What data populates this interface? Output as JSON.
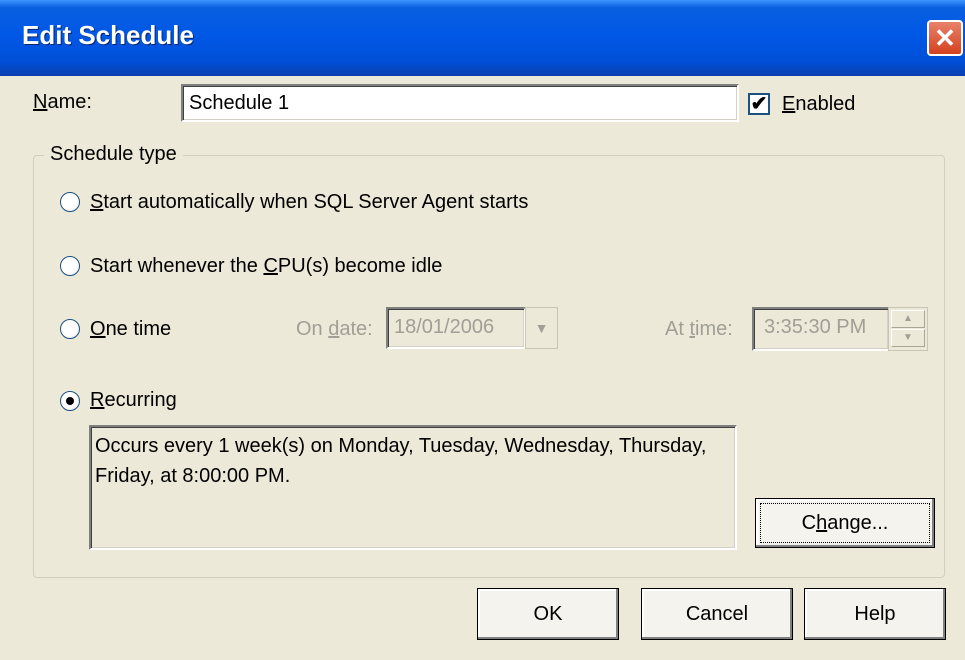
{
  "dialog": {
    "title": "Edit Schedule",
    "close_glyph": "✕"
  },
  "name": {
    "label": "Name:",
    "value": "Schedule 1"
  },
  "enabled": {
    "label": "Enabled",
    "checked": true,
    "check_glyph": "✔"
  },
  "schedule_type": {
    "label": "Schedule type",
    "options": [
      {
        "label": "Start automatically when SQL Server Agent starts",
        "selected": false
      },
      {
        "label": "Start whenever the CPU(s) become idle",
        "selected": false
      },
      {
        "label": "One time",
        "selected": false
      },
      {
        "label": "Recurring",
        "selected": true
      }
    ],
    "on_date_label": "On date:",
    "on_date_value": "18/01/2006",
    "at_time_label": "At time:",
    "at_time_value": "3:35:30 PM",
    "recurring_description": "Occurs every 1 week(s) on Monday, Tuesday, Wednesday, Thursday, Friday, at 8:00:00 PM.",
    "change_button": "Change..."
  },
  "buttons": {
    "ok": "OK",
    "cancel": "Cancel",
    "help": "Help"
  },
  "icons": {
    "dropdown": "chevron-down-icon",
    "spin_up": "spin-up-icon",
    "spin_down": "spin-down-icon",
    "close": "close-icon"
  },
  "colors": {
    "titlebar": "#0058e6",
    "dialog_bg": "#ece9d8",
    "close_button": "#d4411f"
  }
}
